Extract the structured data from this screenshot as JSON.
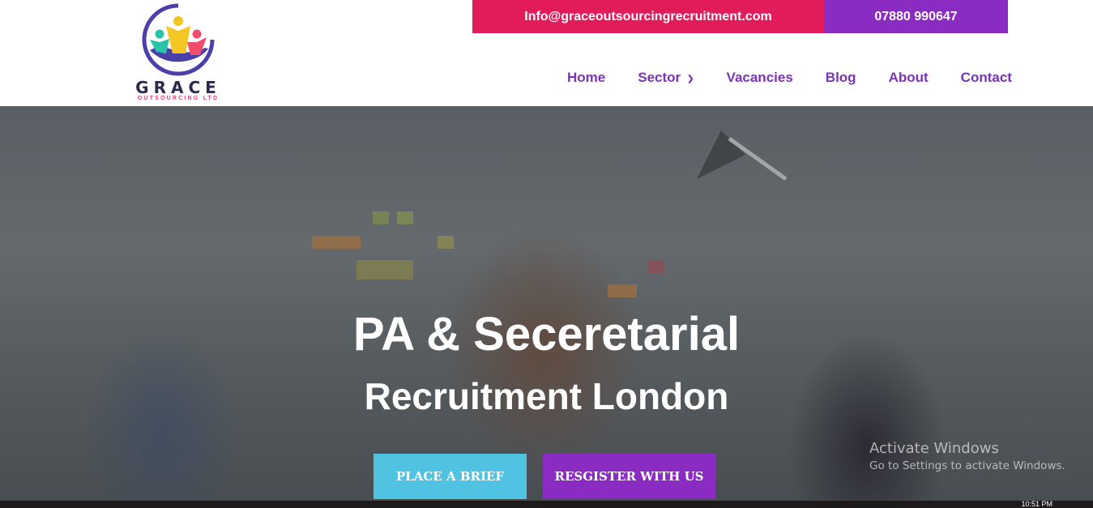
{
  "header": {
    "logo": {
      "name": "GRACE",
      "subtitle": "OUTSOURCING LTD",
      "colors": {
        "ring": "#4b3fa8",
        "teal": "#2cc4a8",
        "yellow": "#f3c623",
        "pink": "#ef4d6b",
        "hand": "#4b3fa8"
      }
    },
    "contact": {
      "email": "Info@graceoutsourcingrecruitment.com",
      "phone": "07880 990647",
      "email_bg": "#e21b5b",
      "phone_bg": "#8a2bc2"
    },
    "nav": [
      {
        "label": "Home"
      },
      {
        "label": "Sector",
        "icon": "chevron-down-icon"
      },
      {
        "label": "Vacancies"
      },
      {
        "label": "Blog"
      },
      {
        "label": "About"
      },
      {
        "label": "Contact"
      }
    ],
    "nav_color": "#7b33b5"
  },
  "hero": {
    "title": "PA & Seceretarial",
    "subtitle": "Recruitment London",
    "buttons": {
      "brief": "PLACE A BRIEF",
      "register": "RESGISTER WITH US"
    },
    "colors": {
      "brief": "#4fc3e1",
      "register": "#8a2bc2"
    }
  },
  "watermark": {
    "title": "Activate Windows",
    "subtitle": "Go to Settings to activate Windows."
  },
  "taskbar": {
    "clock": "10:51 PM"
  }
}
